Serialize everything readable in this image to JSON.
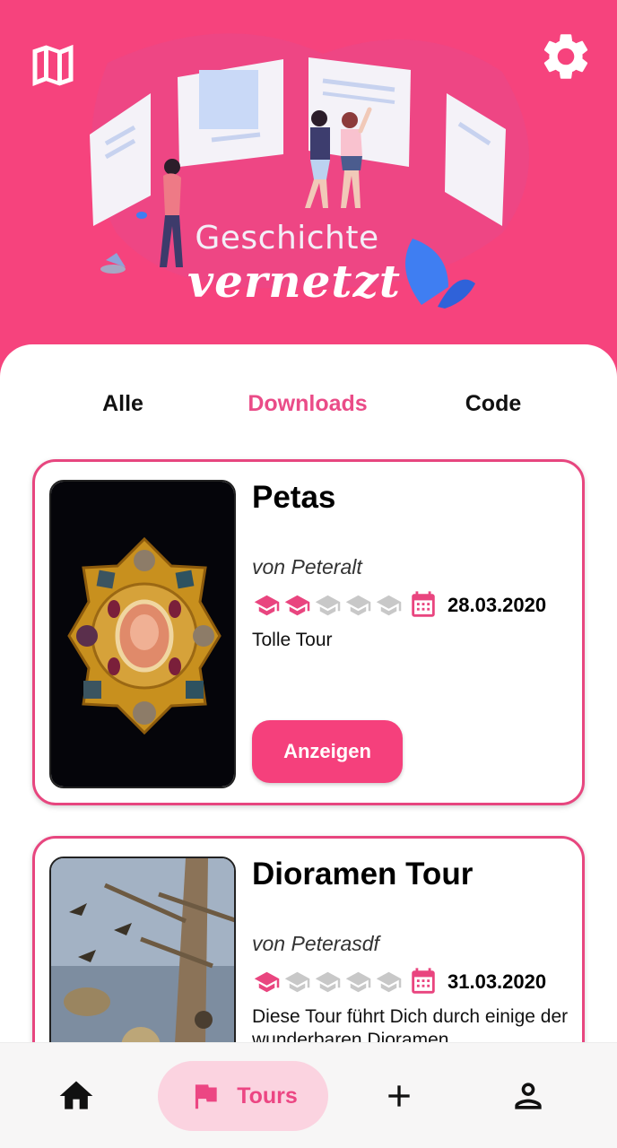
{
  "header": {
    "title_line1": "Geschichte",
    "title_line2": "vernetzt",
    "left_icon": "map-icon",
    "right_icon": "gear-icon"
  },
  "tabs": [
    {
      "label": "Alle",
      "active": false
    },
    {
      "label": "Downloads",
      "active": true
    },
    {
      "label": "Code",
      "active": false
    }
  ],
  "tours": [
    {
      "title": "Petas",
      "author": "von Peteralt",
      "difficulty": 2,
      "difficulty_max": 5,
      "date": "28.03.2020",
      "description": "Tolle Tour",
      "button_label": "Anzeigen",
      "image": "golden-brooch"
    },
    {
      "title": "Dioramen Tour",
      "author": "von Peterasdf",
      "difficulty": 1,
      "difficulty_max": 5,
      "date": "31.03.2020",
      "description": "Diese Tour führt Dich durch einige der wunderbaren Dioramen",
      "image": "animal-diorama"
    }
  ],
  "bottom_nav": {
    "items": [
      {
        "icon": "home-icon",
        "label": ""
      },
      {
        "icon": "flag-icon",
        "label": "Tours",
        "active": true
      },
      {
        "icon": "plus-icon",
        "label": ""
      },
      {
        "icon": "person-icon",
        "label": ""
      }
    ]
  },
  "colors": {
    "brand": "#f6437d",
    "accent": "#ea4c88",
    "hat_active": "#e9457f",
    "hat_inactive": "#c8c8c8",
    "nav_active_bg": "#fbd3e0"
  }
}
